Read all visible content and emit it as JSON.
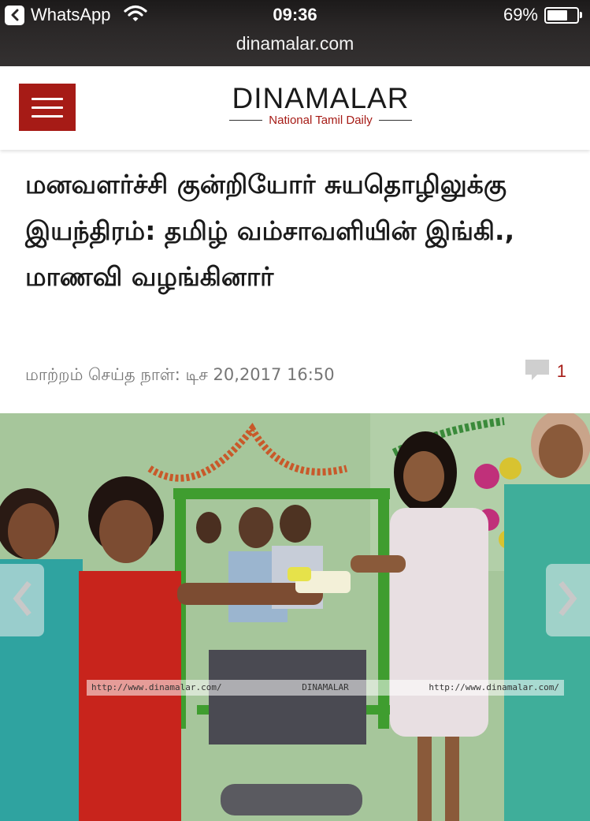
{
  "status_bar": {
    "back_app": "WhatsApp",
    "time": "09:36",
    "battery_percent": "69%",
    "battery_level": 0.69,
    "url": "dinamalar.com"
  },
  "header": {
    "logo_name": "Dinamalar",
    "logo_tagline": "National Tamil Daily",
    "menu_icon": "hamburger-menu-icon",
    "accent_color": "#a61b16"
  },
  "article": {
    "title": "மனவளர்ச்சி குன்றியோர் சுயதொழிலுக்கு இயந்திரம்: தமிழ் வம்சாவளியின் இங்கி., மாணவி வழங்கினார்",
    "updated_label": "மாற்றம் செய்த நாள்:",
    "updated_value": "டிச 20,2017 16:50",
    "comment_count": "1",
    "comment_icon": "comment-bubble-icon"
  },
  "photo": {
    "watermark_left": "http://www.dinamalar.com/",
    "watermark_center": "DINAMALAR",
    "watermark_right": "http://www.dinamalar.com/",
    "prev_icon": "chevron-left-icon",
    "next_icon": "chevron-right-icon"
  }
}
